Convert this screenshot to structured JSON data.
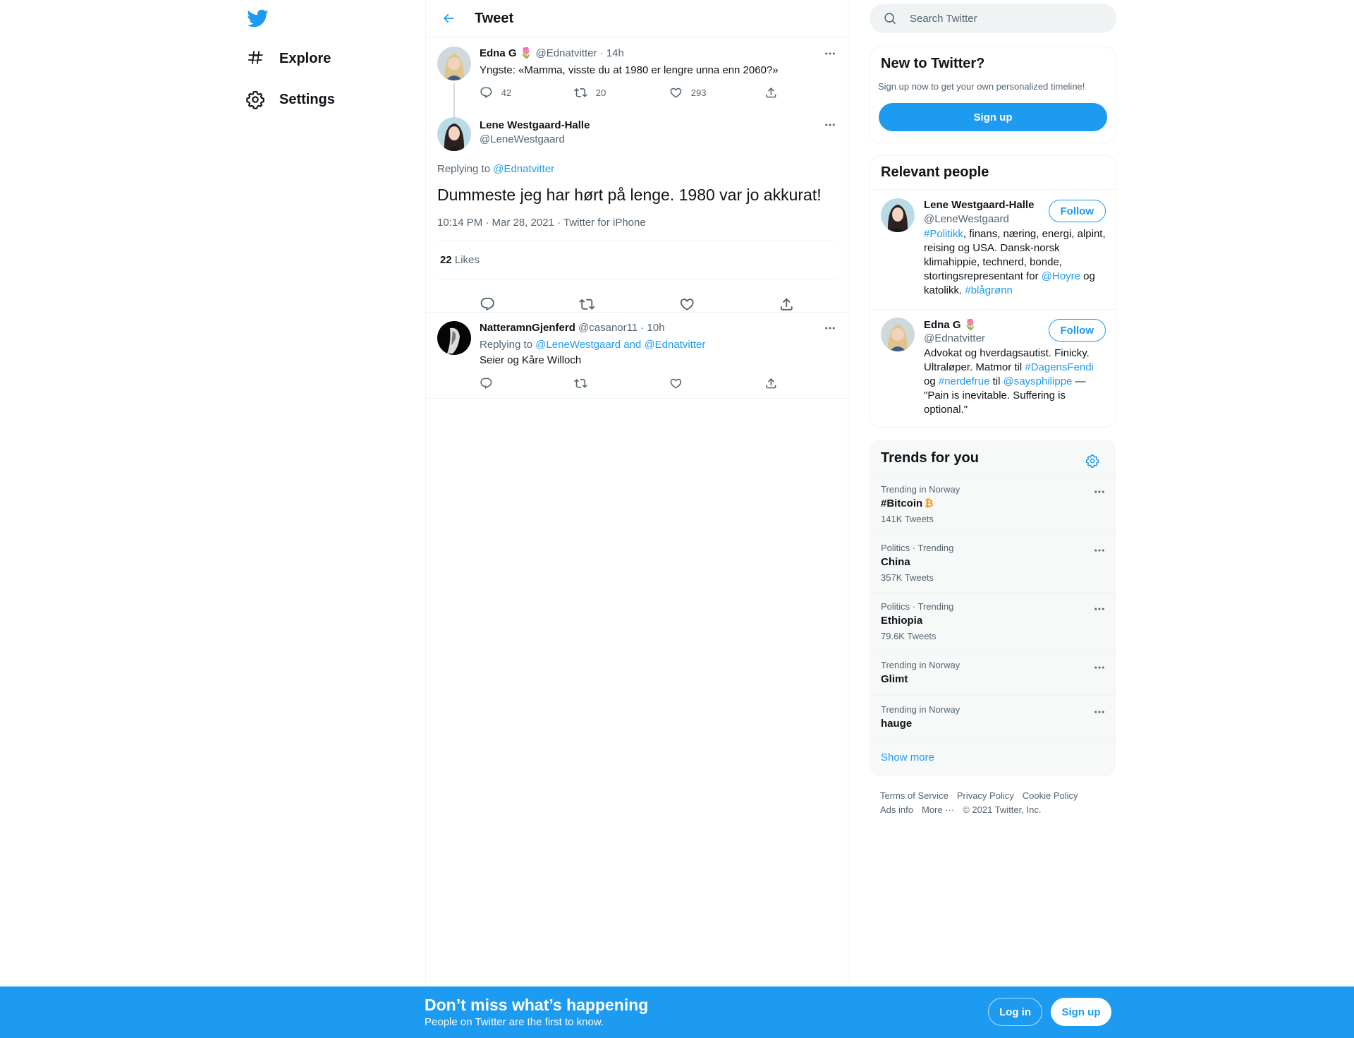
{
  "nav": {
    "explore_label": "Explore",
    "settings_label": "Settings"
  },
  "header": {
    "title": "Tweet"
  },
  "parent_tweet": {
    "name": "Edna G",
    "emoji": "🌷",
    "handle": "@Ednatvitter",
    "time": "· 14h",
    "text": "Yngste: «Mamma, visste du at 1980 er lengre unna enn 2060?»",
    "replies": "42",
    "retweets": "20",
    "likes": "293"
  },
  "main_tweet": {
    "name": "Lene Westgaard-Halle",
    "handle": "@LeneWestgaard",
    "replying_prefix": "Replying to",
    "replying_to": "@Ednatvitter",
    "text": "Dummeste jeg har hørt på lenge. 1980 var jo akkurat!",
    "timestamp": "10:14 PM · Mar 28, 2021 · Twitter for iPhone",
    "likes_count": "22",
    "likes_label": "Likes"
  },
  "reply_tweet": {
    "name": "NatteramnGjenferd",
    "handle": "@casanor11",
    "time": "· 10h",
    "replying_prefix": "Replying to",
    "replying_to": "@LeneWestgaard and @Ednatvitter",
    "text": "Seier og Kåre Willoch"
  },
  "search": {
    "placeholder": "Search Twitter"
  },
  "signup_card": {
    "title": "New to Twitter?",
    "subtitle": "Sign up now to get your own personalized timeline!",
    "button": "Sign up"
  },
  "relevant": {
    "title": "Relevant people",
    "people": [
      {
        "name": "Lene Westgaard-Halle",
        "handle": "@LeneWestgaard",
        "follow": "Follow",
        "bio": {
          "tag1": "#Politikk",
          "text1": ", finans, næring, energi, alpint, reising og USA. Dansk-norsk klimahippie, technerd, bonde, stortingsrepresentant for ",
          "mention1": "@Hoyre",
          "text2": " og katolikk. ",
          "tag2": "#blågrønn"
        }
      },
      {
        "name": "Edna G",
        "emoji": "🌷",
        "handle": "@Ednatvitter",
        "follow": "Follow",
        "bio": {
          "text1": "Advokat og hverdagsautist. Finicky. Ultraløper. Matmor til ",
          "tag1": "#DagensFendi",
          "text2": " og ",
          "tag2": "#nerdefrue",
          "text3": " til ",
          "mention1": "@saysphilippe",
          "text4": " — \"Pain is inevitable. Suffering is optional.\""
        }
      }
    ]
  },
  "trends": {
    "title": "Trends for you",
    "items": [
      {
        "category": "Trending in Norway",
        "name": "#Bitcoin",
        "count": "141K Tweets"
      },
      {
        "category": "Politics · Trending",
        "name": "China",
        "count": "357K Tweets"
      },
      {
        "category": "Politics · Trending",
        "name": "Ethiopia",
        "count": "79.6K Tweets"
      },
      {
        "category": "Trending in Norway",
        "name": "Glimt",
        "count": ""
      },
      {
        "category": "Trending in Norway",
        "name": "hauge",
        "count": ""
      }
    ],
    "show_more": "Show more"
  },
  "footer": {
    "links": [
      "Terms of Service",
      "Privacy Policy",
      "Cookie Policy",
      "Ads info",
      "More ···"
    ],
    "copyright": "© 2021 Twitter, Inc."
  },
  "bottom_bar": {
    "title": "Don’t miss what’s happening",
    "subtitle": "People on Twitter are the first to know.",
    "login": "Log in",
    "signup": "Sign up"
  },
  "colors": {
    "accent": "#1d9bf0",
    "text": "#0f1419",
    "secondary": "#536471",
    "border": "#eff3f4",
    "bitcoin": "#f7931a"
  }
}
